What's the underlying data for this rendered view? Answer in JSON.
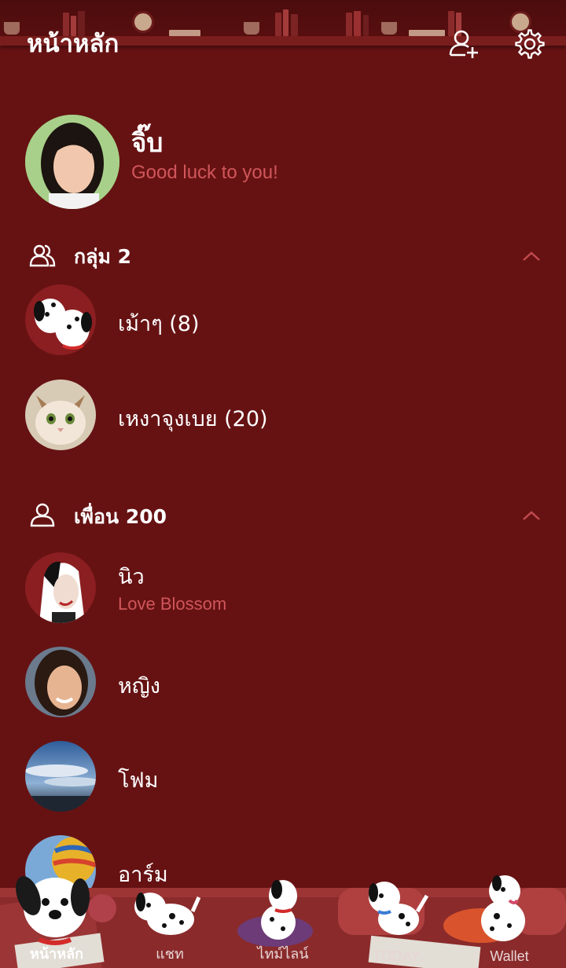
{
  "header": {
    "title": "หน้าหลัก",
    "add_friend_icon": "add-friend-icon",
    "settings_icon": "gear-icon"
  },
  "profile": {
    "name": "จิ๊บ",
    "status": "Good luck to you!"
  },
  "groups_section": {
    "title": "กลุ่ม 2",
    "icon": "group-icon",
    "items": [
      {
        "name": "เม้าๆ (8)"
      },
      {
        "name": "เหงาจุงเบย (20)"
      }
    ]
  },
  "friends_section": {
    "title": "เพื่อน 200",
    "icon": "person-icon",
    "items": [
      {
        "name": "นิว",
        "status": "Love Blossom"
      },
      {
        "name": "หญิง"
      },
      {
        "name": "โฟม"
      },
      {
        "name": "อาร์ม"
      }
    ]
  },
  "tabs": [
    {
      "label": "หน้าหลัก"
    },
    {
      "label": "แชท"
    },
    {
      "label": "ไทม์ไลน์"
    },
    {
      "label": "TODAY"
    },
    {
      "label": "Wallet"
    }
  ],
  "colors": {
    "background": "#661213",
    "status": "#d0565a"
  }
}
